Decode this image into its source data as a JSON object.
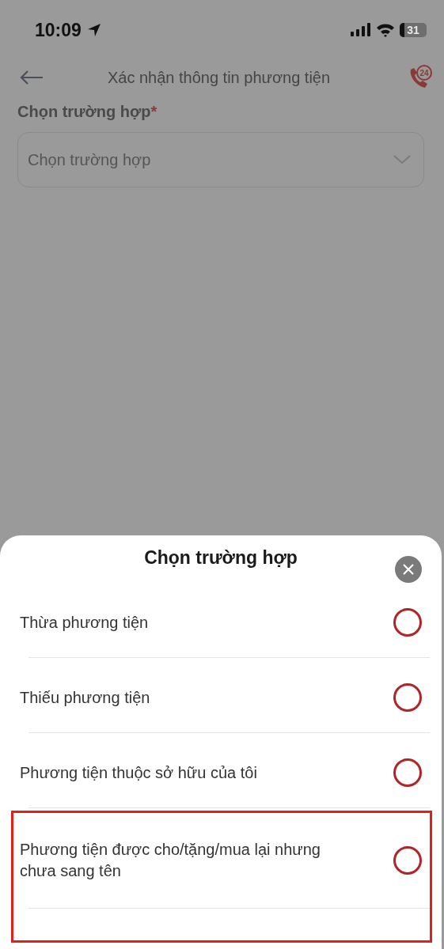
{
  "status_bar": {
    "time": "10:09",
    "battery": "31"
  },
  "header": {
    "title": "Xác nhận thông tin phương tiện",
    "hotline_badge": "24"
  },
  "form": {
    "label": "Chọn trường hợp",
    "required_mark": "*",
    "select": {
      "placeholder": "Chọn trường hợp"
    }
  },
  "sheet": {
    "title": "Chọn trường hợp",
    "options": [
      {
        "label": "Thừa phương tiện",
        "selected": false,
        "highlighted": false
      },
      {
        "label": "Thiếu phương tiện",
        "selected": false,
        "highlighted": false
      },
      {
        "label": "Phương tiện thuộc sở hữu của tôi",
        "selected": false,
        "highlighted": false
      },
      {
        "label": "Phương tiện được cho/tặng/mua lại nhưng chưa sang tên",
        "selected": false,
        "highlighted": true
      }
    ]
  }
}
